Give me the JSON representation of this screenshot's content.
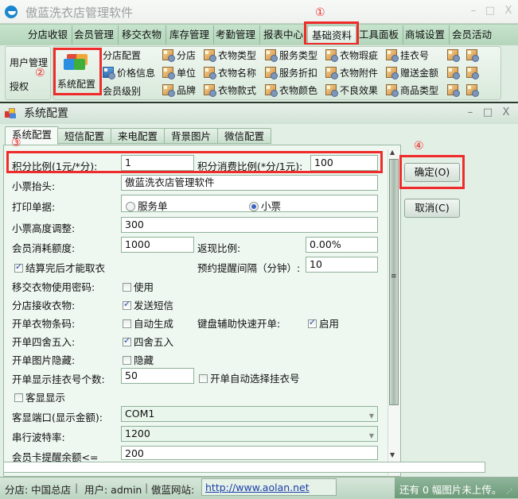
{
  "window": {
    "title": "傲蓝洗衣店管理软件",
    "controls": [
      "–",
      "□",
      "X"
    ]
  },
  "menu": {
    "tabs": [
      "分店收银",
      "会员管理",
      "移交衣物",
      "库存管理",
      "考勤管理",
      "报表中心",
      "基础资料",
      "工具面板",
      "商城设置",
      "会员活动"
    ],
    "active_index": 6
  },
  "ribbon": {
    "left_group": [
      "用户管理",
      "授权"
    ],
    "big_button": "系统配置",
    "column_a": [
      "分店配置",
      "价格信息",
      "会员级别"
    ],
    "columns": [
      [
        "分店",
        "单位",
        "品牌"
      ],
      [
        "衣物类型",
        "衣物名称",
        "衣物款式"
      ],
      [
        "服务类型",
        "服务折扣",
        "衣物颜色"
      ],
      [
        "衣物瑕疵",
        "衣物附件",
        "不良效果"
      ],
      [
        "挂衣号",
        "赠送金额",
        "商品类型"
      ]
    ]
  },
  "annotations": [
    "①",
    "②",
    "③",
    "④"
  ],
  "dialog": {
    "title": "系统配置",
    "tabs": [
      "系统配置",
      "短信配置",
      "来电配置",
      "背景图片",
      "微信配置"
    ],
    "active_tab": 0,
    "fields": {
      "points_ratio_label": "积分比例(1元/*分):",
      "points_ratio_value": "1",
      "points_consume_label": "积分消费比例(*分/1元):",
      "points_consume_value": "100",
      "receipt_header_label": "小票抬头:",
      "receipt_header_value": "傲蓝洗衣店管理软件",
      "print_label": "打印单据:",
      "print_options": [
        "服务单",
        "小票"
      ],
      "print_selected": "小票",
      "receipt_height_label": "小票高度调整:",
      "receipt_height_value": "300",
      "member_quota_label": "会员消耗额度:",
      "member_quota_value": "1000",
      "cashback_label": "返现比例:",
      "cashback_value": "0.00%",
      "settle_before_pickup": "结算完后才能取衣",
      "reminder_interval_label": "预约提醒间隔（分钟）:",
      "reminder_interval_value": "10",
      "transfer_password_label": "移交衣物使用密码:",
      "transfer_password_option": "使用",
      "branch_receive_label": "分店接收衣物:",
      "branch_receive_option": "发送短信",
      "barcode_label": "开单衣物条码:",
      "barcode_option": "自动生成",
      "keyboard_label": "键盘辅助快速开单:",
      "keyboard_option": "启用",
      "rounding_label": "开单四舍五入:",
      "rounding_option": "四舍五入",
      "hide_images_label": "开单图片隐藏:",
      "hide_images_option": "隐藏",
      "tag_count_label": "开单显示挂衣号个数:",
      "tag_count_value": "50",
      "auto_tag_option": "开单自动选择挂衣号",
      "customer_display_option": "客显显示",
      "display_port_label": "客显端口(显示金额):",
      "display_port_value": "COM1",
      "baud_label": "串行波特率:",
      "baud_value": "1200",
      "card_balance_label": "会员卡提醒余额<=",
      "card_balance_value": "200"
    },
    "checks": {
      "settle_before_pickup": true,
      "transfer_password": false,
      "branch_receive": true,
      "barcode": false,
      "keyboard": true,
      "rounding": true,
      "hide_images": false,
      "auto_tag": false,
      "customer_display": false
    },
    "buttons": {
      "ok": "确定(O)",
      "cancel": "取消(C)"
    }
  },
  "status": {
    "branch": "分店: 中国总店",
    "user": "用户: admin",
    "site_label": "傲蓝网站:",
    "site_url": "http://www.aolan.net",
    "upload": "还有 0 幅图片未上传。"
  },
  "colors": {
    "highlight": "#ef2b2b",
    "accent_green": "#b4d6bb"
  }
}
